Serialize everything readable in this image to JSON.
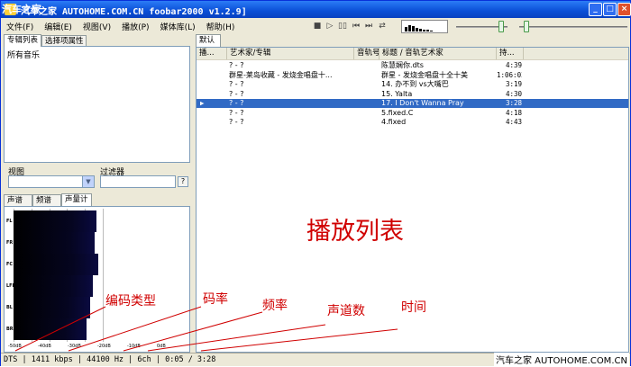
{
  "window": {
    "title": "汽车之家 AUTOHOME.COM.CN foobar2000 v1.2.9]"
  },
  "menu": {
    "items": [
      "文件(F)",
      "编辑(E)",
      "视图(V)",
      "播放(P)",
      "媒体库(L)",
      "帮助(H)"
    ]
  },
  "toolbar": {
    "icons": [
      "stop-icon",
      "play-icon",
      "pause-icon",
      "previous-icon",
      "next-icon",
      "random-icon"
    ]
  },
  "left": {
    "tabs": [
      "专辑列表",
      "选择项属性"
    ],
    "tree_items": [
      "所有音乐"
    ],
    "view_label": "视图",
    "filter_label": "过滤器",
    "help_button": "?",
    "viz_tabs": [
      "声谱",
      "频谱",
      "声量计"
    ],
    "meter_channels": [
      "FL",
      "FR",
      "FC",
      "LFE",
      "BL",
      "BR"
    ],
    "meter_levels": [
      0.4,
      0.39,
      0.41,
      0.38,
      0.36,
      0.34
    ],
    "meter_ticks": [
      "-50dB",
      "-40dB",
      "-30dB",
      "-20dB",
      "-10dB",
      "0dB"
    ]
  },
  "playlist": {
    "tab": "默认",
    "columns": [
      "播...",
      "艺术家/专辑",
      "音轨号",
      "标题 / 音轨艺术家",
      "持..."
    ],
    "rows": [
      {
        "playing": "",
        "artist": "? - ?",
        "track": "",
        "title": "陈慧娴你.dts",
        "duration": "4:39"
      },
      {
        "playing": "",
        "artist": "群星-莱岛收藏 - 发烧金唱盘十...",
        "track": "",
        "title": "群星 - 发烧金唱盘十全十美",
        "duration": "1:06:02"
      },
      {
        "playing": "",
        "artist": "? - ?",
        "track": "",
        "title": "14. 办不到 vs大嘴巴",
        "duration": "3:19"
      },
      {
        "playing": "",
        "artist": "? - ?",
        "track": "",
        "title": "15. Yalta",
        "duration": "4:30"
      },
      {
        "playing": "▶",
        "artist": "? - ?",
        "track": "",
        "title": "17. I Don't Wanna Pray",
        "duration": "3:28",
        "selected": true
      },
      {
        "playing": "",
        "artist": "? - ?",
        "track": "",
        "title": "5.fixed.C",
        "duration": "4:18"
      },
      {
        "playing": "",
        "artist": "? - ?",
        "track": "",
        "title": "4.fixed",
        "duration": "4:43"
      }
    ],
    "big_label": "播放列表"
  },
  "annotations": [
    "编码类型",
    "码率",
    "频率",
    "声道数",
    "时间"
  ],
  "status": "DTS | 1411 kbps | 44100 Hz | 6ch | 0:05 / 3:28",
  "watermarks": [
    "汽车之家",
    "汽车之家 AUTOHOME.COM.CN"
  ],
  "colors": {
    "selection": "#316ac5",
    "annotation": "#d00000",
    "title_bar": "#0a4fd6"
  }
}
